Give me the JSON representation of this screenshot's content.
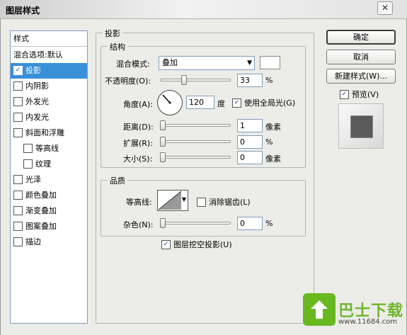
{
  "window": {
    "title": "图层样式",
    "close_glyph": "✕"
  },
  "style_list": {
    "header": "样式",
    "blend_default": "混合选项:默认",
    "items": [
      {
        "label": "投影",
        "checked": true,
        "selected": true
      },
      {
        "label": "内阴影",
        "checked": false
      },
      {
        "label": "外发光",
        "checked": false
      },
      {
        "label": "内发光",
        "checked": false
      },
      {
        "label": "斜面和浮雕",
        "checked": false
      },
      {
        "label": "等高线",
        "checked": false
      },
      {
        "label": "纹理",
        "checked": false
      },
      {
        "label": "光泽",
        "checked": false
      },
      {
        "label": "颜色叠加",
        "checked": false
      },
      {
        "label": "渐变叠加",
        "checked": false
      },
      {
        "label": "图案叠加",
        "checked": false
      },
      {
        "label": "描边",
        "checked": false
      }
    ]
  },
  "drop_shadow": {
    "section_title": "投影",
    "structure_title": "结构",
    "blend_mode_label": "混合模式:",
    "blend_mode_value": "叠加",
    "opacity_label": "不透明度(O):",
    "opacity_value": "33",
    "opacity_unit": "%",
    "angle_label": "角度(A):",
    "angle_value": "120",
    "angle_unit": "度",
    "global_light_label": "使用全局光(G)",
    "global_light_checked": true,
    "distance_label": "距离(D):",
    "distance_value": "1",
    "distance_unit": "像素",
    "spread_label": "扩展(R):",
    "spread_value": "0",
    "spread_unit": "%",
    "size_label": "大小(S):",
    "size_value": "0",
    "size_unit": "像素"
  },
  "quality": {
    "section_title": "品质",
    "contour_label": "等高线:",
    "antialias_label": "消除锯齿(L)",
    "antialias_checked": false,
    "noise_label": "杂色(N):",
    "noise_value": "0",
    "noise_unit": "%",
    "knockout_label": "图层挖空投影(U)",
    "knockout_checked": true
  },
  "buttons": {
    "ok": "确定",
    "cancel": "取消",
    "new_style": "新建样式(W)...",
    "preview_label": "预览(V)",
    "preview_checked": true
  },
  "watermark": {
    "brand": "巴士下载",
    "url": "www.11684.com"
  },
  "colors": {
    "selection": "#3a8fd9",
    "accent_green": "#68b81f",
    "preview_square": "#5a5a5a"
  }
}
